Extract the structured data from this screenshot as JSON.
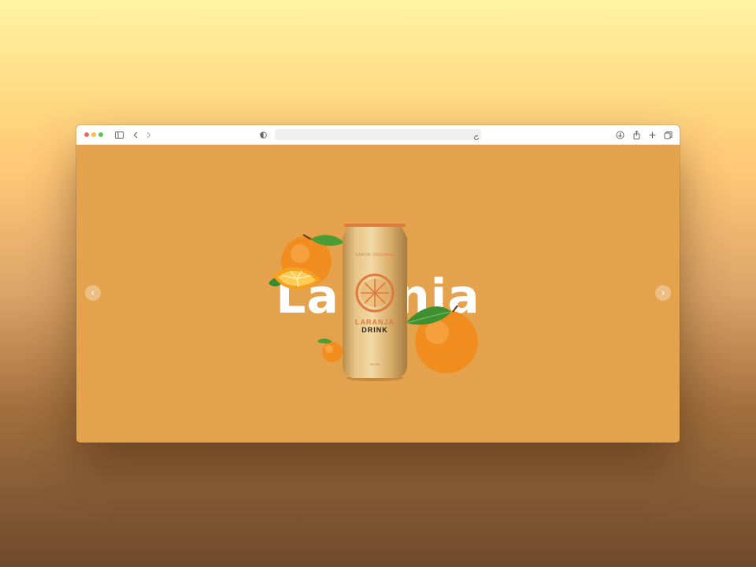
{
  "browser": {
    "url": "",
    "traffic_lights": {
      "close": "#ec6a5e",
      "minimize": "#f4bf4f",
      "maximize": "#61c554"
    },
    "icons": [
      "sidebar-toggle-icon",
      "back-icon",
      "forward-icon",
      "privacy-shield-icon",
      "reload-icon",
      "download-icon",
      "share-icon",
      "new-tab-icon",
      "tab-overview-icon"
    ]
  },
  "hero": {
    "title": "Laranja",
    "background_color": "#e5a24c"
  },
  "can": {
    "tagline": "SABOR ORIGINAL",
    "brand_line1": "LARANJA",
    "brand_line2": "DRINK",
    "volume": "350 ML",
    "accent_color": "#e07a3a"
  },
  "carousel": {
    "prev_icon": "chevron-left-icon",
    "next_icon": "chevron-right-icon"
  }
}
